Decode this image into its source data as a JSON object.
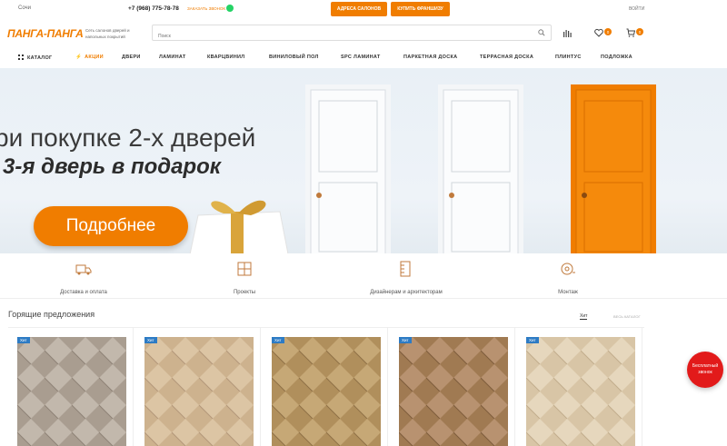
{
  "topbar": {
    "city": "Сочи",
    "phone": "+7 (968) 775-78-78",
    "callback": "заказать звонок",
    "btn_salons": "Адреса салонов",
    "btn_franchise": "Купить франшизу",
    "login": "Войти"
  },
  "header": {
    "logo": "ПАНГА-ПАНГА",
    "logo_sub": "Сеть салонов дверей и напольных покрытий",
    "search_placeholder": "Поиск",
    "favorites_count": "0",
    "cart_count": "0"
  },
  "nav": {
    "items": [
      "Каталог",
      "Акции",
      "Двери",
      "Ламинат",
      "Кварцвинил",
      "Виниловый пол",
      "SPC ламинат",
      "Паркетная доска",
      "Террасная доска",
      "Плинтус",
      "Подложка"
    ]
  },
  "hero": {
    "line1": "ри покупке 2-х дверей",
    "line2": "3-я дверь в подарок",
    "button": "Подробнее"
  },
  "features": [
    "Доставка и оплата",
    "Проекты",
    "Дизайнерам и архитекторам",
    "Монтаж"
  ],
  "offers": {
    "title": "Горящие предложения",
    "tab_hit": "Хит",
    "tab_all": "Весь каталог",
    "cards": [
      {
        "badge": "Хит"
      },
      {
        "badge": "Хит"
      },
      {
        "badge": "Хит"
      },
      {
        "badge": "Хит"
      },
      {
        "badge": "Хит"
      }
    ]
  },
  "callbtn": {
    "line1": "Бесплатный",
    "line2": "звонок"
  },
  "colors": {
    "accent": "#f07d00",
    "badge": "#2d7bc4",
    "call": "#e21a1a"
  }
}
